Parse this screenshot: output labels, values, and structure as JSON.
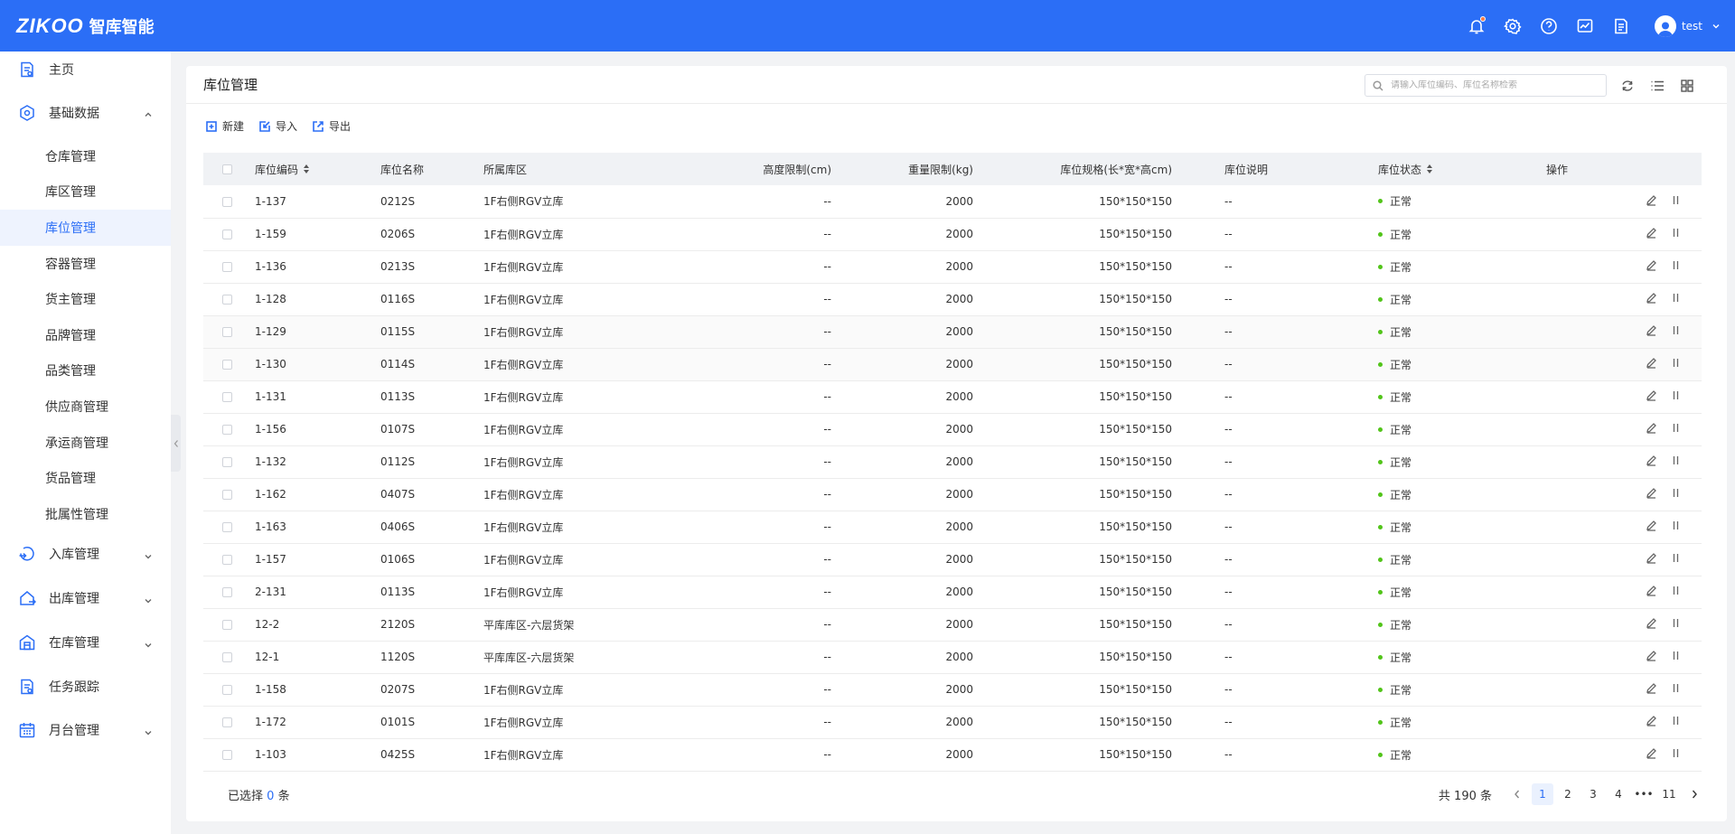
{
  "header": {
    "logo_en": "ZIKOO",
    "logo_cn": "智库智能",
    "username": "test"
  },
  "sidebar": {
    "home": "主页",
    "basic_data": "基础数据",
    "sub_items": [
      {
        "label": "仓库管理",
        "active": false
      },
      {
        "label": "库区管理",
        "active": false
      },
      {
        "label": "库位管理",
        "active": true
      },
      {
        "label": "容器管理",
        "active": false
      },
      {
        "label": "货主管理",
        "active": false
      },
      {
        "label": "品牌管理",
        "active": false
      },
      {
        "label": "品类管理",
        "active": false
      },
      {
        "label": "供应商管理",
        "active": false
      },
      {
        "label": "承运商管理",
        "active": false
      },
      {
        "label": "货品管理",
        "active": false
      },
      {
        "label": "批属性管理",
        "active": false
      }
    ],
    "inbound": "入库管理",
    "outbound": "出库管理",
    "inventory": "在库管理",
    "task_tracking": "任务跟踪",
    "dock": "月台管理"
  },
  "page": {
    "title": "库位管理",
    "search_placeholder": "请输入库位编码、库位名称检索"
  },
  "toolbar": {
    "new_label": "新建",
    "import_label": "导入",
    "export_label": "导出"
  },
  "table": {
    "columns": {
      "code": "库位编码",
      "name": "库位名称",
      "zone": "所属库区",
      "height": "高度限制(cm)",
      "weight": "重量限制(kg)",
      "spec": "库位规格(长*宽*高cm)",
      "desc": "库位说明",
      "status": "库位状态",
      "ops": "操作"
    },
    "rows": [
      {
        "code": "1-137",
        "name": "0212S",
        "zone": "1F右侧RGV立库",
        "height": "--",
        "weight": "2000",
        "spec": "150*150*150",
        "desc": "--",
        "status": "正常"
      },
      {
        "code": "1-159",
        "name": "0206S",
        "zone": "1F右侧RGV立库",
        "height": "--",
        "weight": "2000",
        "spec": "150*150*150",
        "desc": "--",
        "status": "正常"
      },
      {
        "code": "1-136",
        "name": "0213S",
        "zone": "1F右侧RGV立库",
        "height": "--",
        "weight": "2000",
        "spec": "150*150*150",
        "desc": "--",
        "status": "正常"
      },
      {
        "code": "1-128",
        "name": "0116S",
        "zone": "1F右侧RGV立库",
        "height": "--",
        "weight": "2000",
        "spec": "150*150*150",
        "desc": "--",
        "status": "正常"
      },
      {
        "code": "1-129",
        "name": "0115S",
        "zone": "1F右侧RGV立库",
        "height": "--",
        "weight": "2000",
        "spec": "150*150*150",
        "desc": "--",
        "status": "正常"
      },
      {
        "code": "1-130",
        "name": "0114S",
        "zone": "1F右侧RGV立库",
        "height": "--",
        "weight": "2000",
        "spec": "150*150*150",
        "desc": "--",
        "status": "正常"
      },
      {
        "code": "1-131",
        "name": "0113S",
        "zone": "1F右侧RGV立库",
        "height": "--",
        "weight": "2000",
        "spec": "150*150*150",
        "desc": "--",
        "status": "正常"
      },
      {
        "code": "1-156",
        "name": "0107S",
        "zone": "1F右侧RGV立库",
        "height": "--",
        "weight": "2000",
        "spec": "150*150*150",
        "desc": "--",
        "status": "正常"
      },
      {
        "code": "1-132",
        "name": "0112S",
        "zone": "1F右侧RGV立库",
        "height": "--",
        "weight": "2000",
        "spec": "150*150*150",
        "desc": "--",
        "status": "正常"
      },
      {
        "code": "1-162",
        "name": "0407S",
        "zone": "1F右侧RGV立库",
        "height": "--",
        "weight": "2000",
        "spec": "150*150*150",
        "desc": "--",
        "status": "正常"
      },
      {
        "code": "1-163",
        "name": "0406S",
        "zone": "1F右侧RGV立库",
        "height": "--",
        "weight": "2000",
        "spec": "150*150*150",
        "desc": "--",
        "status": "正常"
      },
      {
        "code": "1-157",
        "name": "0106S",
        "zone": "1F右侧RGV立库",
        "height": "--",
        "weight": "2000",
        "spec": "150*150*150",
        "desc": "--",
        "status": "正常"
      },
      {
        "code": "2-131",
        "name": "0113S",
        "zone": "1F右侧RGV立库",
        "height": "--",
        "weight": "2000",
        "spec": "150*150*150",
        "desc": "--",
        "status": "正常"
      },
      {
        "code": "12-2",
        "name": "2120S",
        "zone": "平库库区-六层货架",
        "height": "--",
        "weight": "2000",
        "spec": "150*150*150",
        "desc": "--",
        "status": "正常"
      },
      {
        "code": "12-1",
        "name": "1120S",
        "zone": "平库库区-六层货架",
        "height": "--",
        "weight": "2000",
        "spec": "150*150*150",
        "desc": "--",
        "status": "正常"
      },
      {
        "code": "1-158",
        "name": "0207S",
        "zone": "1F右侧RGV立库",
        "height": "--",
        "weight": "2000",
        "spec": "150*150*150",
        "desc": "--",
        "status": "正常"
      },
      {
        "code": "1-172",
        "name": "0101S",
        "zone": "1F右侧RGV立库",
        "height": "--",
        "weight": "2000",
        "spec": "150*150*150",
        "desc": "--",
        "status": "正常"
      },
      {
        "code": "1-103",
        "name": "0425S",
        "zone": "1F右侧RGV立库",
        "height": "--",
        "weight": "2000",
        "spec": "150*150*150",
        "desc": "--",
        "status": "正常"
      }
    ]
  },
  "footer": {
    "selected_prefix": "已选择",
    "selected_count": "0",
    "selected_suffix": "条",
    "total_text": "共 190 条",
    "pages": [
      "1",
      "2",
      "3",
      "4",
      "•••",
      "11"
    ],
    "current_page": "1"
  },
  "colors": {
    "brand": "#2b6ef6",
    "status_ok": "#52c41a"
  }
}
